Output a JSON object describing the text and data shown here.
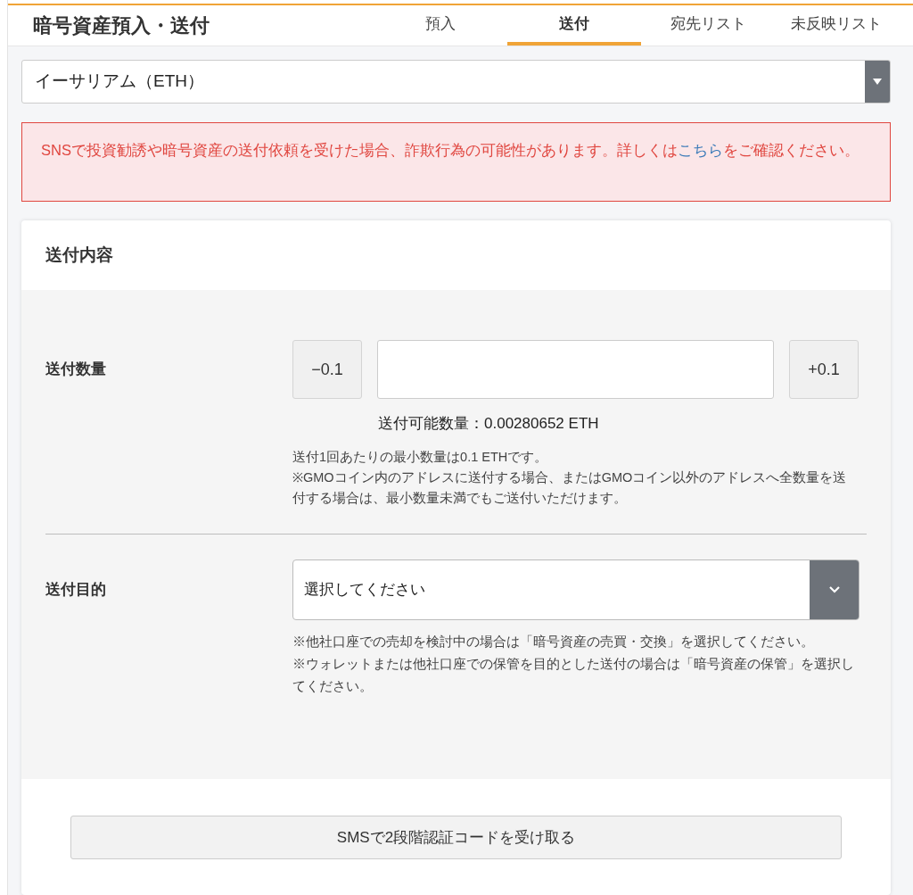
{
  "header": {
    "title": "暗号資産預入・送付"
  },
  "tabs": [
    {
      "label": "預入",
      "selected": false
    },
    {
      "label": "送付",
      "selected": true
    },
    {
      "label": "宛先リスト",
      "selected": false
    },
    {
      "label": "未反映リスト",
      "selected": false
    }
  ],
  "currency_select": {
    "value": "イーサリアム（ETH）"
  },
  "warning": {
    "text_before": "SNSで投資勧誘や暗号資産の送付依頼を受けた場合、詐欺行為の可能性があります。詳しくは",
    "link": "こちら",
    "text_after": "をご確認ください。"
  },
  "card": {
    "title": "送付内容",
    "amount": {
      "label": "送付数量",
      "minus_button": "−0.1",
      "plus_button": "+0.1",
      "available": "送付可能数量：0.00280652 ETH",
      "notes": [
        "送付1回あたりの最小数量は0.1 ETHです。",
        "※GMOコイン内のアドレスに送付する場合、またはGMOコイン以外のアドレスへ全数量を送付する場合は、最小数量未満でもご送付いただけます。"
      ]
    },
    "purpose": {
      "label": "送付目的",
      "placeholder": "選択してください",
      "notes": [
        "※他社口座での売却を検討中の場合は「暗号資産の売買・交換」を選択してください。",
        "※ウォレットまたは他社口座での保管を目的とした送付の場合は「暗号資産の保管」を選択してください。"
      ]
    },
    "sms_button": "SMSで2段階認証コードを受け取る"
  }
}
